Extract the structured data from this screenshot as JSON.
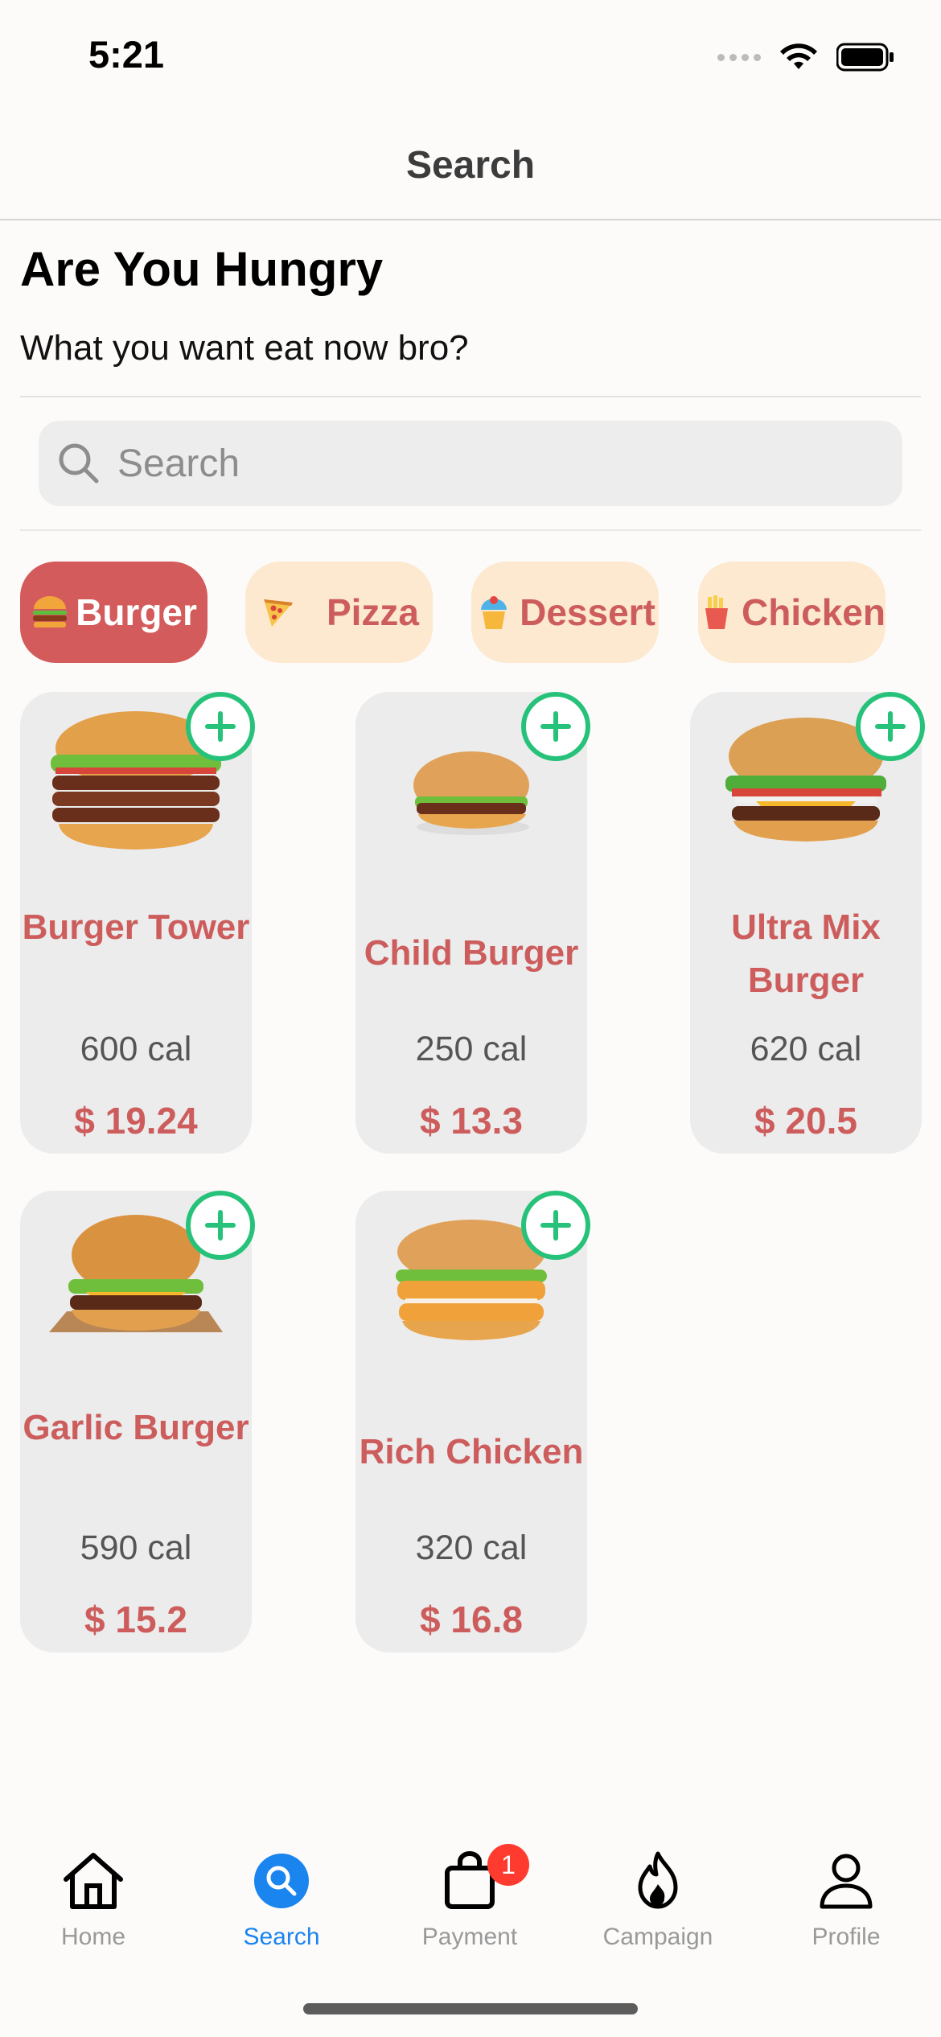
{
  "status_bar": {
    "time": "5:21"
  },
  "nav": {
    "title": "Search"
  },
  "header": {
    "title": "Are You Hungry",
    "subtitle": "What you want eat now bro?"
  },
  "search": {
    "placeholder": "Search",
    "value": ""
  },
  "categories": [
    {
      "label": "Burger",
      "icon": "burger-icon",
      "active": true
    },
    {
      "label": "Pizza",
      "icon": "pizza-icon",
      "active": false
    },
    {
      "label": "Dessert",
      "icon": "cupcake-icon",
      "active": false
    },
    {
      "label": "Chicken",
      "icon": "fries-icon",
      "active": false
    }
  ],
  "products": [
    {
      "name": "Burger Tower",
      "calories": "600 cal",
      "price": "$ 19.24"
    },
    {
      "name": "Child Burger",
      "calories": "250 cal",
      "price": "$ 13.3"
    },
    {
      "name": "Ultra Mix Burger",
      "calories": "620 cal",
      "price": "$ 20.5"
    },
    {
      "name": "Garlic Burger",
      "calories": "590 cal",
      "price": "$ 15.2"
    },
    {
      "name": "Rich Chicken",
      "calories": "320 cal",
      "price": "$ 16.8"
    }
  ],
  "tabs": [
    {
      "label": "Home",
      "icon": "home-icon",
      "active": false
    },
    {
      "label": "Search",
      "icon": "search-icon",
      "active": true
    },
    {
      "label": "Payment",
      "icon": "bag-icon",
      "active": false,
      "badge": "1"
    },
    {
      "label": "Campaign",
      "icon": "flame-icon",
      "active": false
    },
    {
      "label": "Profile",
      "icon": "person-icon",
      "active": false
    }
  ],
  "colors": {
    "accent": "#cd5d5d",
    "chip_bg": "#fde9cf",
    "add_green": "#27c27a",
    "tab_active": "#1a84ef"
  }
}
